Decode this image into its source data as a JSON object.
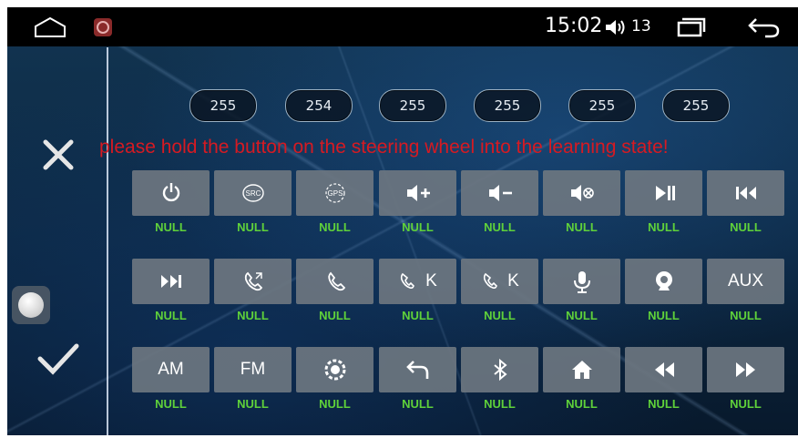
{
  "status_bar": {
    "time": "15:02",
    "volume_level": "13",
    "icons": [
      "home-icon",
      "app-icon",
      "volume-icon",
      "recents-icon",
      "back-icon"
    ]
  },
  "codes": [
    "255",
    "254",
    "255",
    "255",
    "255",
    "255"
  ],
  "instruction": "please hold the button on the steering wheel into the learning state!",
  "keys": [
    {
      "icon": "power-icon",
      "text": "",
      "label": "NULL"
    },
    {
      "icon": "src-icon",
      "text": "SRC",
      "label": "NULL"
    },
    {
      "icon": "gps-icon",
      "text": "GPS",
      "label": "NULL"
    },
    {
      "icon": "volume-up-icon",
      "text": "",
      "label": "NULL"
    },
    {
      "icon": "volume-down-icon",
      "text": "",
      "label": "NULL"
    },
    {
      "icon": "mute-icon",
      "text": "",
      "label": "NULL"
    },
    {
      "icon": "play-pause-icon",
      "text": "",
      "label": "NULL"
    },
    {
      "icon": "previous-icon",
      "text": "",
      "label": "NULL"
    },
    {
      "icon": "next-icon",
      "text": "",
      "label": "NULL"
    },
    {
      "icon": "phone-answer-icon",
      "text": "",
      "label": "NULL"
    },
    {
      "icon": "phone-hangup-icon",
      "text": "",
      "label": "NULL"
    },
    {
      "icon": "phone-answer-k-icon",
      "text": "K",
      "label": "NULL"
    },
    {
      "icon": "phone-hangup-k-icon",
      "text": "K",
      "label": "NULL"
    },
    {
      "icon": "microphone-icon",
      "text": "",
      "label": "NULL"
    },
    {
      "icon": "camera-icon",
      "text": "",
      "label": "NULL"
    },
    {
      "icon": "",
      "text": "AUX",
      "label": "NULL"
    },
    {
      "icon": "",
      "text": "AM",
      "label": "NULL"
    },
    {
      "icon": "",
      "text": "FM",
      "label": "NULL"
    },
    {
      "icon": "settings-icon",
      "text": "",
      "label": "NULL"
    },
    {
      "icon": "return-icon",
      "text": "",
      "label": "NULL"
    },
    {
      "icon": "bluetooth-icon",
      "text": "",
      "label": "NULL"
    },
    {
      "icon": "home-icon",
      "text": "",
      "label": "NULL"
    },
    {
      "icon": "rewind-icon",
      "text": "",
      "label": "NULL"
    },
    {
      "icon": "fast-forward-icon",
      "text": "",
      "label": "NULL"
    }
  ],
  "colors": {
    "instruction": "#d61a22",
    "key_label": "#5fd13a",
    "key_background": "#6c7680"
  }
}
